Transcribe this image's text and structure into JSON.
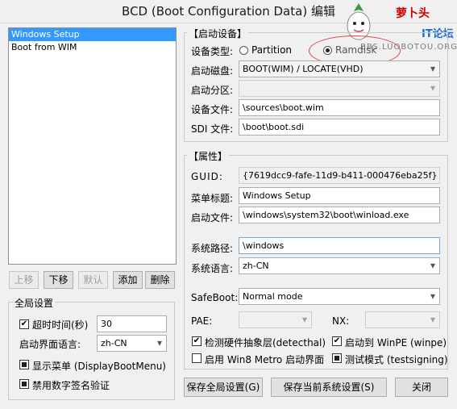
{
  "window": {
    "title": "BCD (Boot Configuration Data) 编辑"
  },
  "watermark": {
    "brand_cn": "萝卜头",
    "brand_it": "IT论坛",
    "url": "BBS.LUOBOTOU.ORG"
  },
  "entries": [
    "Windows Setup",
    "Boot from WIM"
  ],
  "list_buttons": {
    "up": "上移",
    "down": "下移",
    "default": "默认",
    "add": "添加",
    "delete": "删除"
  },
  "global": {
    "group_title": "全局设置",
    "timeout_label": "超时时间(秒)",
    "timeout_value": "30",
    "lang_label": "启动界面语言:",
    "lang_value": "zh-CN",
    "show_menu": "显示菜单 (DisplayBootMenu)",
    "disable_sig": "禁用数字签名验证"
  },
  "boot_device": {
    "group_title": "【启动设备】",
    "type_label": "设备类型:",
    "type_partition": "Partition",
    "type_ramdisk": "Ramdisk",
    "disk_label": "启动磁盘:",
    "disk_value": "BOOT(WIM) / LOCATE(VHD)",
    "partition_label": "启动分区:",
    "file_label": "设备文件:",
    "file_value": "\\sources\\boot.wim",
    "sdi_label": "SDI 文件:",
    "sdi_value": "\\boot\\boot.sdi"
  },
  "props": {
    "group_title": "【属性】",
    "guid_label": "GUID:",
    "guid_value": "{7619dcc9-fafe-11d9-b411-000476eba25f}",
    "menu_title_label": "菜单标题:",
    "menu_title_value": "Windows Setup",
    "boot_file_label": "启动文件:",
    "boot_file_value": "\\windows\\system32\\boot\\winload.exe",
    "sys_path_label": "系统路径:",
    "sys_path_value": "\\windows",
    "sys_lang_label": "系统语言:",
    "sys_lang_value": "zh-CN",
    "safeboot_label": "SafeBoot:",
    "safeboot_value": "Normal mode",
    "pae_label": "PAE:",
    "nx_label": "NX:",
    "detect_hal": "检测硬件抽象层(detecthal)",
    "winpe": "启动到 WinPE (winpe)",
    "metro": "启用 Win8 Metro 启动界面",
    "testsigning": "测试模式 (testsigning)"
  },
  "footer": {
    "save_global": "保存全局设置(G)",
    "save_current": "保存当前系统设置(S)",
    "close": "关闭"
  },
  "colors": {
    "selection": "#3399ff",
    "annotation": "#e04040",
    "brand_red": "#cc0000",
    "brand_blue": "#1e6fd0"
  }
}
